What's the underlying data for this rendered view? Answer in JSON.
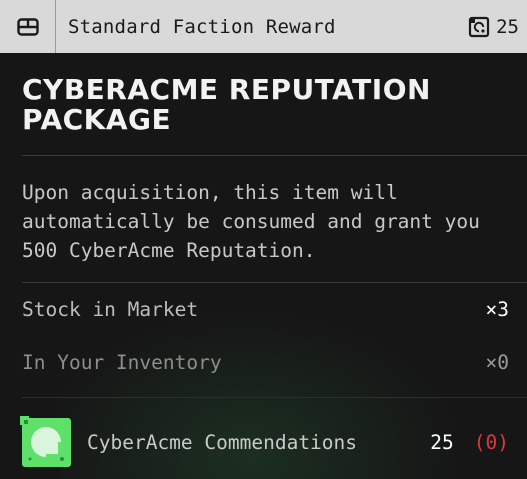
{
  "header": {
    "title": "Standard Faction Reward",
    "price": "25",
    "menu_icon": "grid-box-icon",
    "price_icon": "commendation-currency-icon"
  },
  "item": {
    "name": "CYBERACME REPUTATION PACKAGE",
    "description": "Upon acquisition, this item will automatically be consumed and grant you 500 CyberAcme Reputation."
  },
  "stats": [
    {
      "label": "Stock in Market",
      "value": "×3"
    },
    {
      "label": "In Your Inventory",
      "value": "×0"
    }
  ],
  "currency": {
    "name": "CyberAcme Commendations",
    "amount": "25",
    "owned": "(0)",
    "icon": "cyberacme-commendation-icon"
  },
  "colors": {
    "header_bg": "#d9d9d9",
    "panel_bg": "#161616",
    "accent_green": "#5ee06a",
    "insufficient_red": "#e0363b"
  }
}
